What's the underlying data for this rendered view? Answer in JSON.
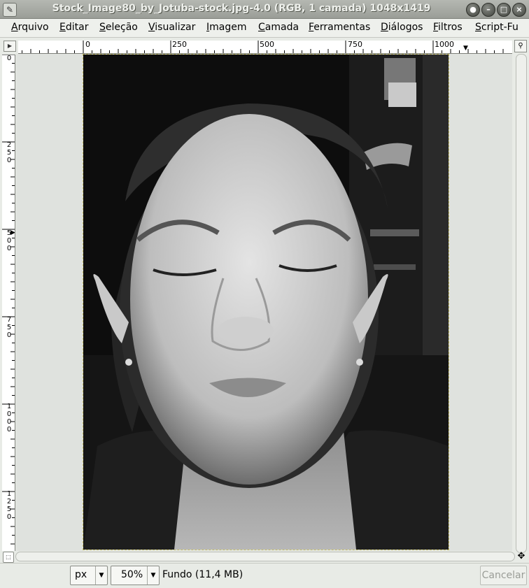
{
  "window": {
    "title": "Stock_Image80_by_Jotuba-stock.jpg-4.0 (RGB, 1 camada) 1048x1419",
    "app_icon": "gimp-icon",
    "buttons": [
      "window-menu-icon",
      "minimize-icon",
      "maximize-icon",
      "close-icon"
    ]
  },
  "menubar": {
    "items": [
      "Arquivo",
      "Editar",
      "Seleção",
      "Visualizar",
      "Imagem",
      "Camada",
      "Ferramentas",
      "Diálogos",
      "Filtros",
      "Script-Fu"
    ]
  },
  "rulers": {
    "horizontal": [
      "0",
      "250",
      "500",
      "750",
      "1000"
    ],
    "vertical": [
      "0",
      "250",
      "500",
      "750",
      "1000",
      "1250"
    ]
  },
  "statusbar": {
    "unit": "px",
    "zoom": "50%",
    "layer_info": "Fundo (11,4 MB)",
    "cancel_label": "Cancelar"
  },
  "colors": {
    "menu_bg": "#eef0ec",
    "canvas_bg": "#dfe2de",
    "image_bg": "#0e0e0e"
  }
}
